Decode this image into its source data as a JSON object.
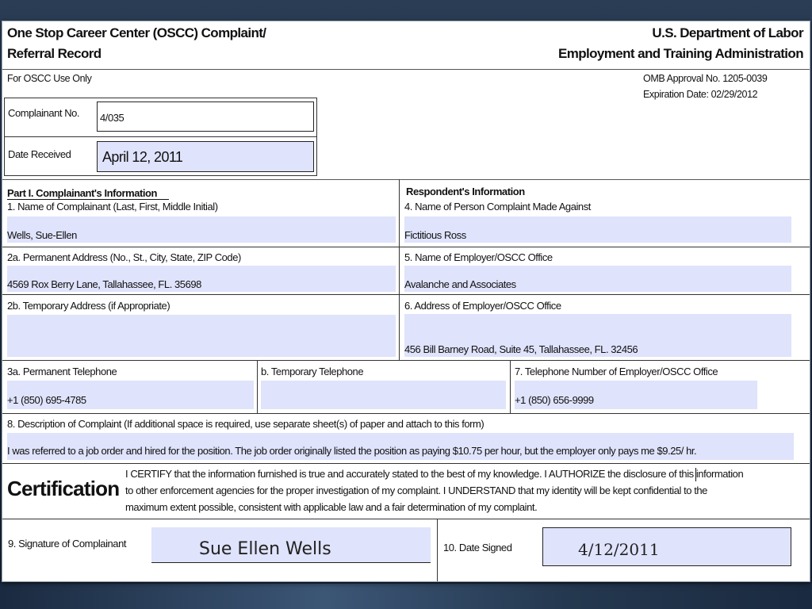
{
  "header": {
    "title_line1": "One Stop Career Center (OSCC) Complaint/",
    "title_line2": "Referral Record",
    "agency_line1": "U.S. Department of Labor",
    "agency_line2": "Employment and Training Administration"
  },
  "office_use": {
    "label": "For OSCC Use Only",
    "omb_approval": "OMB Approval No. 1205-0039",
    "expiration": "Expiration Date: 02/29/2012",
    "complainant_no_label": "Complainant No.",
    "complainant_no_value": "4/035",
    "date_received_label": "Date Received",
    "date_received_value": "April 12, 2011"
  },
  "part1": {
    "heading": "Part I. Complainant's Information",
    "name_label": "1. Name of Complainant (Last, First, Middle Initial)",
    "name_value": "Wells, Sue-Ellen",
    "perm_address_label": "2a. Permanent Address (No., St., City, State, ZIP Code)",
    "perm_address_value": "4569 Rox Berry Lane, Tallahassee, FL. 35698",
    "temp_address_label": "2b. Temporary Address (if Appropriate)",
    "temp_address_value": "",
    "perm_phone_label": "3a. Permanent Telephone",
    "perm_phone_value": "+1 (850) 695-4785",
    "temp_phone_label": "b. Temporary Telephone",
    "temp_phone_value": ""
  },
  "respondent": {
    "heading": "Respondent's Information",
    "person_label": "4. Name of Person Complaint Made Against",
    "person_value": "Fictitious Ross",
    "employer_label": "5. Name of Employer/OSCC Office",
    "employer_value": "Avalanche and Associates",
    "address_label": "6. Address of Employer/OSCC Office",
    "address_value": "456 Bill Barney Road, Suite 45, Tallahassee, FL. 32456",
    "phone_label": "7. Telephone Number of Employer/OSCC Office",
    "phone_value": "+1 (850) 656-9999"
  },
  "description": {
    "label": "8. Description of Complaint (If additional space is required, use separate sheet(s) of paper and attach to this form)",
    "value": "I was referred to a job order and hired for the position. The job order originally listed the position as paying $10.75 per hour, but the employer only pays me $9.25/ hr."
  },
  "certification": {
    "title": "Certification",
    "line1": "I CERTIFY that the information furnished is true and accurately stated to the best of my knowledge. I AUTHORIZE the disclosure of this information",
    "line2": "to other enforcement agencies for the proper investigation of my complaint. I UNDERSTAND that my identity will be kept confidential to the",
    "line3": "maximum extent possible, consistent with applicable law and a fair determination of my complaint."
  },
  "signature": {
    "label": "9. Signature of Complainant",
    "value": "Sue Ellen Wells",
    "tab_icon": "sign-here-flag-icon",
    "date_label": "10. Date Signed",
    "date_value": "4/12/2011"
  },
  "colors": {
    "field_fill": "#dfe3fb",
    "sign_tab": "#e2553a"
  }
}
